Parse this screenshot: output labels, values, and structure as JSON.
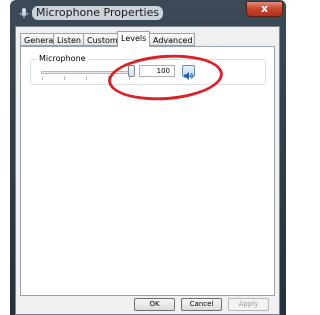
{
  "window": {
    "title": "Microphone Properties",
    "close_label": "x"
  },
  "tabs": [
    {
      "label": "General",
      "active": false
    },
    {
      "label": "Listen",
      "active": false
    },
    {
      "label": "Custom",
      "active": false
    },
    {
      "label": "Levels",
      "active": true
    },
    {
      "label": "Advanced",
      "active": false
    }
  ],
  "levels": {
    "group_label": "Microphone",
    "level_value": "100",
    "slider_fraction": 1.0,
    "mute_icon": "speaker-icon"
  },
  "buttons": {
    "ok": "OK",
    "cancel": "Cancel",
    "apply": "Apply",
    "apply_disabled": true
  },
  "annotation_color": "#d6252a"
}
